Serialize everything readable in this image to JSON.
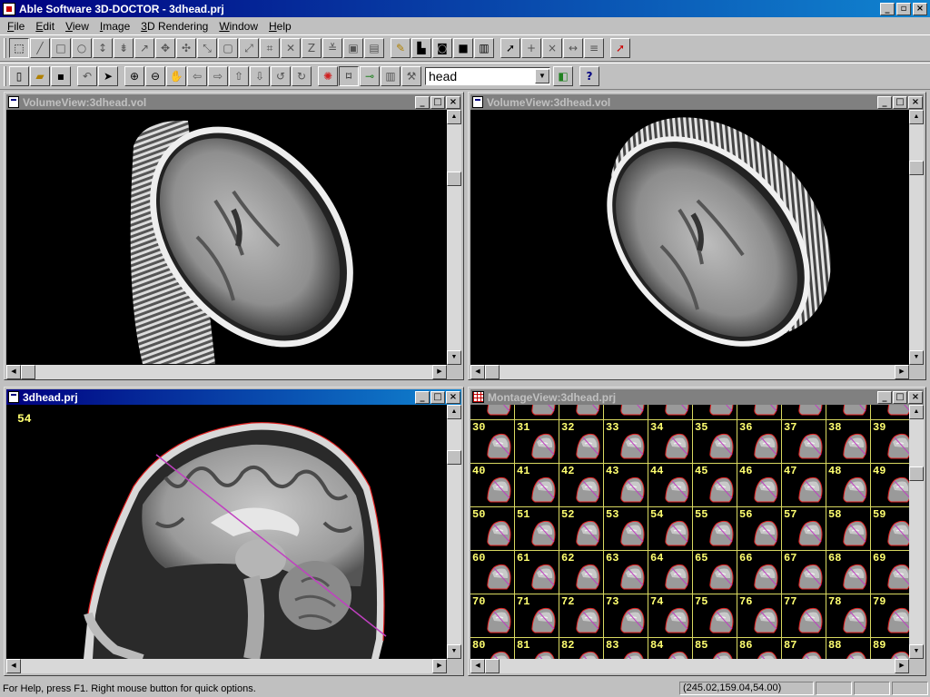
{
  "window": {
    "title": "Able Software 3D-DOCTOR - 3dhead.prj"
  },
  "menu": [
    "File",
    "Edit",
    "View",
    "Image",
    "3D Rendering",
    "Window",
    "Help"
  ],
  "toolbar2": {
    "combo_value": "head"
  },
  "windows": {
    "volume_left": {
      "title": "VolumeView:3dhead.vol"
    },
    "volume_right": {
      "title": "VolumeView:3dhead.vol"
    },
    "slice": {
      "title": "3dhead.prj",
      "slice_number": "54"
    },
    "montage": {
      "title": "MontageView:3dhead.prj"
    }
  },
  "montage_rows": [
    [
      "30",
      "31",
      "32",
      "33",
      "34",
      "35",
      "36",
      "37",
      "38",
      "39"
    ],
    [
      "40",
      "41",
      "42",
      "43",
      "44",
      "45",
      "46",
      "47",
      "48",
      "49"
    ],
    [
      "50",
      "51",
      "52",
      "53",
      "54",
      "55",
      "56",
      "57",
      "58",
      "59"
    ],
    [
      "60",
      "61",
      "62",
      "63",
      "64",
      "65",
      "66",
      "67",
      "68",
      "69"
    ],
    [
      "70",
      "71",
      "72",
      "73",
      "74",
      "75",
      "76",
      "77",
      "78",
      "79"
    ],
    [
      "80",
      "81",
      "82",
      "83",
      "84",
      "85",
      "86",
      "87",
      "88",
      "89"
    ]
  ],
  "status": {
    "help": "For Help, press F1. Right mouse button for quick options.",
    "coords": "(245.02,159.04,54.00)"
  },
  "colors": {
    "title_active": "#000080",
    "contour": "#e02020",
    "cut_line": "#c040c0",
    "label": "#ffff70"
  }
}
